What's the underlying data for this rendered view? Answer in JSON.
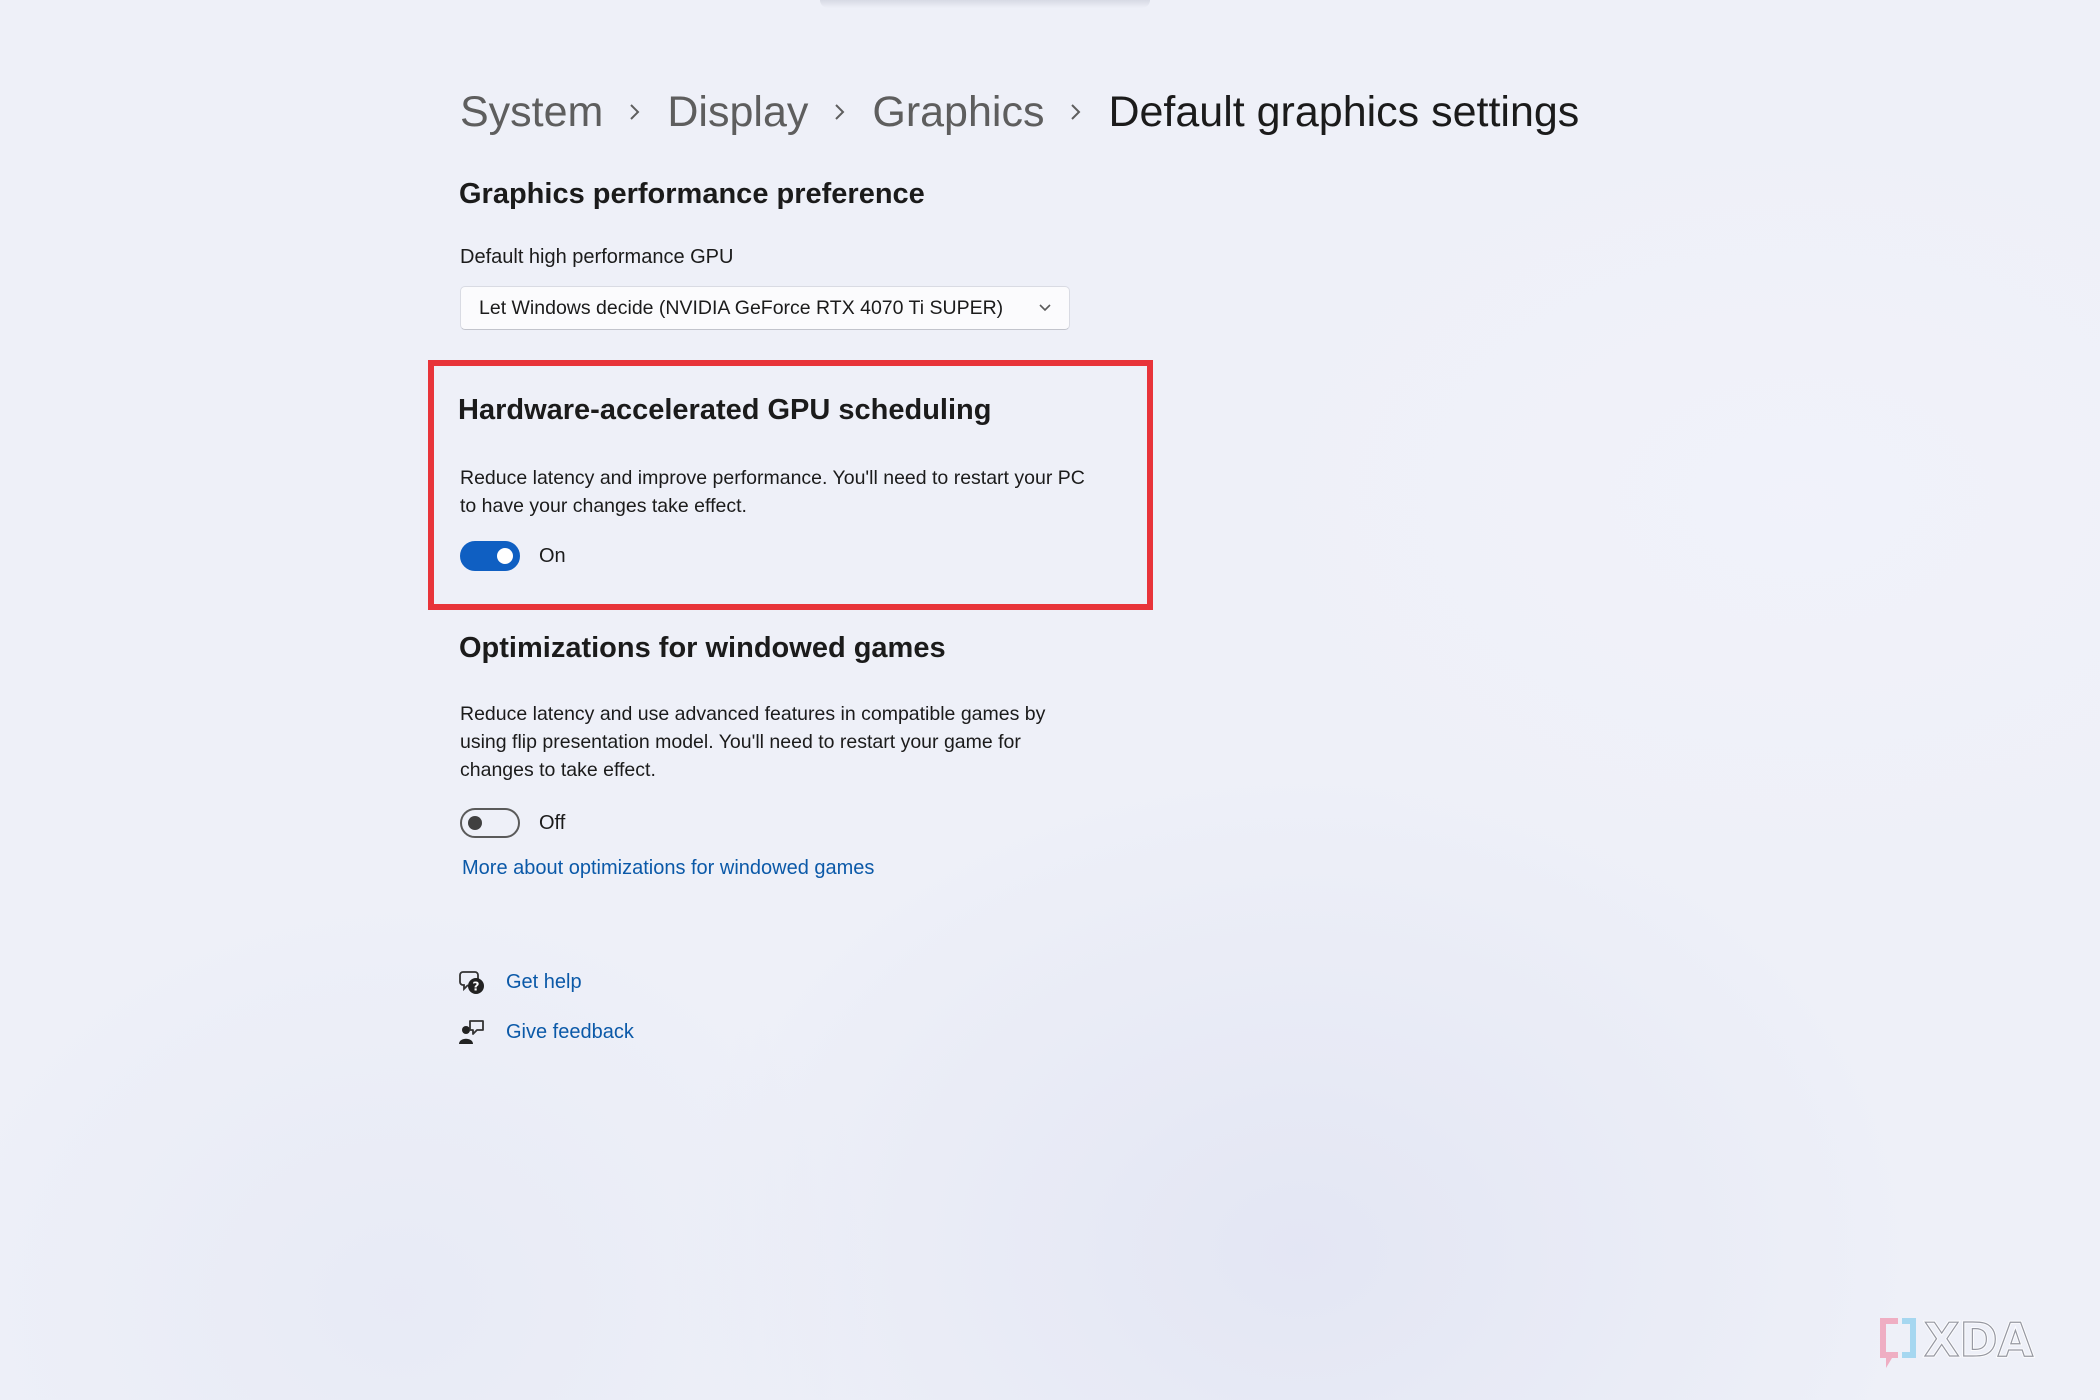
{
  "breadcrumb": {
    "items": [
      "System",
      "Display",
      "Graphics"
    ],
    "current": "Default graphics settings"
  },
  "performance": {
    "title": "Graphics performance preference",
    "gpu_label": "Default high performance GPU",
    "gpu_selected": "Let Windows decide (NVIDIA GeForce RTX 4070 Ti SUPER)"
  },
  "hags": {
    "title": "Hardware-accelerated GPU scheduling",
    "description_line1": "Reduce latency and improve performance. You'll need to restart your PC",
    "description_line2": "to have your changes take effect.",
    "toggle_state": "On",
    "enabled": true
  },
  "windowed": {
    "title": "Optimizations for windowed games",
    "description_line1": "Reduce latency and use advanced features in compatible games by",
    "description_line2": "using flip presentation model. You'll need to restart your game for",
    "description_line3": "changes to take effect.",
    "toggle_state": "Off",
    "enabled": false,
    "more_link": "More about optimizations for windowed games"
  },
  "help": {
    "get_help": "Get help",
    "give_feedback": "Give feedback"
  },
  "colors": {
    "accent": "#0f5fc2",
    "link": "#0b59a8",
    "highlight": "#e8343a",
    "background": "#eef0f8"
  },
  "icons": {
    "breadcrumb_separator": "chevron-right-icon",
    "dropdown": "chevron-down-icon",
    "get_help": "help-chat-icon",
    "give_feedback": "feedback-person-icon"
  },
  "watermark": {
    "text": "XDA"
  }
}
